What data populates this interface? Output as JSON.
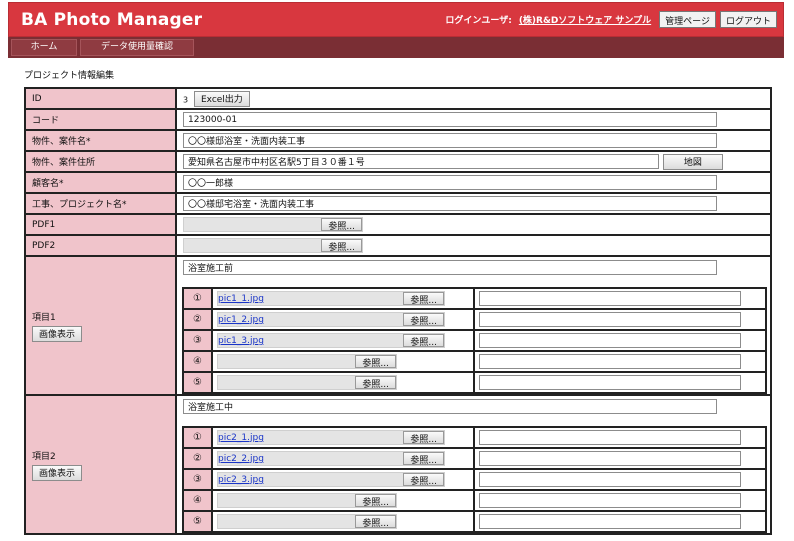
{
  "header": {
    "title": "BA Photo Manager",
    "user_label": "ログインユーザ:",
    "user_name": "(株)R&Dソフトウェア サンプル",
    "admin_button": "管理ページ",
    "logout_button": "ログアウト"
  },
  "nav": {
    "home": "ホーム",
    "usage": "データ使用量確認"
  },
  "page": {
    "section_title": "プロジェクト情報編集"
  },
  "form": {
    "id": {
      "label": "ID",
      "value": "3",
      "excel_button": "Excel出力"
    },
    "code": {
      "label": "コード",
      "value": "123000-01"
    },
    "property_name": {
      "label": "物件、案件名*",
      "value": "〇〇様邸浴室・洗面内装工事"
    },
    "property_address": {
      "label": "物件、案件住所",
      "value": "愛知県名古屋市中村区名駅5丁目３０番１号",
      "map_button": "地図"
    },
    "customer": {
      "label": "顧客名*",
      "value": "〇〇一郎様"
    },
    "project_name": {
      "label": "工事、プロジェクト名*",
      "value": "〇〇様邸宅浴室・洗面内装工事"
    },
    "pdf1": {
      "label": "PDF1",
      "browse": "参照..."
    },
    "pdf2": {
      "label": "PDF2",
      "browse": "参照..."
    }
  },
  "items": [
    {
      "label": "項目1",
      "view_button": "画像表示",
      "title": "浴室施工前",
      "photos": [
        {
          "num": "①",
          "file": "pic1_1.jpg",
          "browse": "参照..."
        },
        {
          "num": "②",
          "file": "pic1_2.jpg",
          "browse": "参照..."
        },
        {
          "num": "③",
          "file": "pic1_3.jpg",
          "browse": "参照..."
        },
        {
          "num": "④",
          "file": "",
          "browse": "参照..."
        },
        {
          "num": "⑤",
          "file": "",
          "browse": "参照..."
        }
      ]
    },
    {
      "label": "項目2",
      "view_button": "画像表示",
      "title": "浴室施工中",
      "photos": [
        {
          "num": "①",
          "file": "pic2_1.jpg",
          "browse": "参照..."
        },
        {
          "num": "②",
          "file": "pic2_2.jpg",
          "browse": "参照..."
        },
        {
          "num": "③",
          "file": "pic2_3.jpg",
          "browse": "参照..."
        },
        {
          "num": "④",
          "file": "",
          "browse": "参照..."
        },
        {
          "num": "⑤",
          "file": "",
          "browse": "参照..."
        }
      ]
    }
  ],
  "colors": {
    "header": "#d8373f",
    "nav": "#7a2e34",
    "label_bg": "#f0c4cb",
    "link": "#1a35c8"
  }
}
